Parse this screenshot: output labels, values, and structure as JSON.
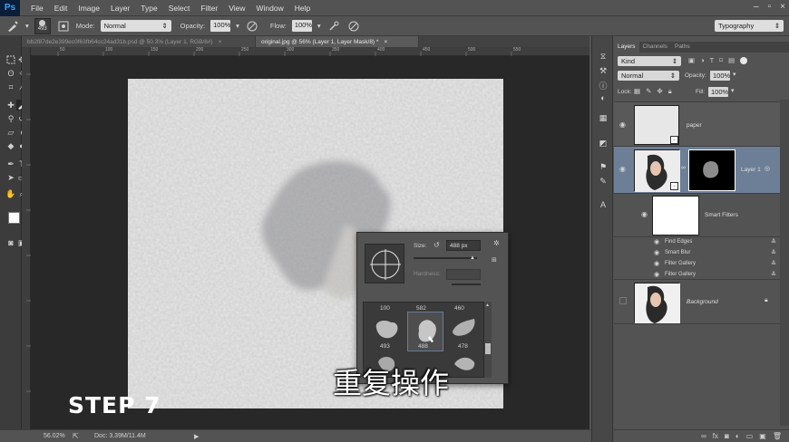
{
  "menubar": {
    "logo": "Ps",
    "items": [
      "File",
      "Edit",
      "Image",
      "Layer",
      "Type",
      "Select",
      "Filter",
      "View",
      "Window",
      "Help"
    ],
    "window_controls": [
      "–",
      "▫",
      "×"
    ]
  },
  "options": {
    "brush_size": "493",
    "mode_label": "Mode:",
    "mode_value": "Normal",
    "opacity_label": "Opacity:",
    "opacity_value": "100%",
    "flow_label": "Flow:",
    "flow_value": "100%",
    "workspace": "Typography"
  },
  "tabs": [
    {
      "label": "bb2f87de2e399ec0f63fb64cc24ad31b.psd @ 50.3% (Layer 1, RGB/8#)",
      "close": "×"
    },
    {
      "label": "original.jpg @ 56% (Layer 1, Layer Mask/8) *",
      "close": "×"
    }
  ],
  "ruler_ticks": [
    "50",
    "100",
    "150",
    "200",
    "250",
    "300",
    "350",
    "400",
    "450",
    "500",
    "550"
  ],
  "brush_picker": {
    "size_label": "Size:",
    "size_value": "488 px",
    "hardness_label": "Hardness:",
    "presets": [
      {
        "size": "100"
      },
      {
        "size": "582"
      },
      {
        "size": "460"
      },
      {
        "size": "493"
      },
      {
        "size": "488"
      },
      {
        "size": "478"
      }
    ]
  },
  "overlay": {
    "step": "STEP 7",
    "caption": "重复操作"
  },
  "status": {
    "zoom": "56.02%",
    "doc": "Doc: 3.39M/11.4M"
  },
  "layers_panel": {
    "tabs": [
      "Layers",
      "Channels",
      "Paths"
    ],
    "kind_label": "Kind",
    "blend_mode": "Normal",
    "opacity_label": "Opacity:",
    "opacity_value": "100%",
    "lock_label": "Lock:",
    "fill_label": "Fill:",
    "fill_value": "100%",
    "layers": [
      {
        "name": "paper"
      },
      {
        "name": "Layer 1"
      },
      {
        "name": "Smart Filters"
      },
      {
        "name": "Background"
      }
    ],
    "filters": [
      "Find Edges",
      "Smart Blur",
      "Filter Gallery",
      "Filter Gallery"
    ],
    "bottom_icons": [
      "link-icon",
      "fx-icon",
      "mask-icon",
      "adjustment-icon",
      "group-icon",
      "new-layer-icon",
      "trash-icon"
    ]
  },
  "colors": {
    "ui_bg": "#535353",
    "canvas_bg": "#282828",
    "paper": "#e4e4e4",
    "selected_layer": "#6d7f96",
    "accent": "#31a8ff"
  }
}
